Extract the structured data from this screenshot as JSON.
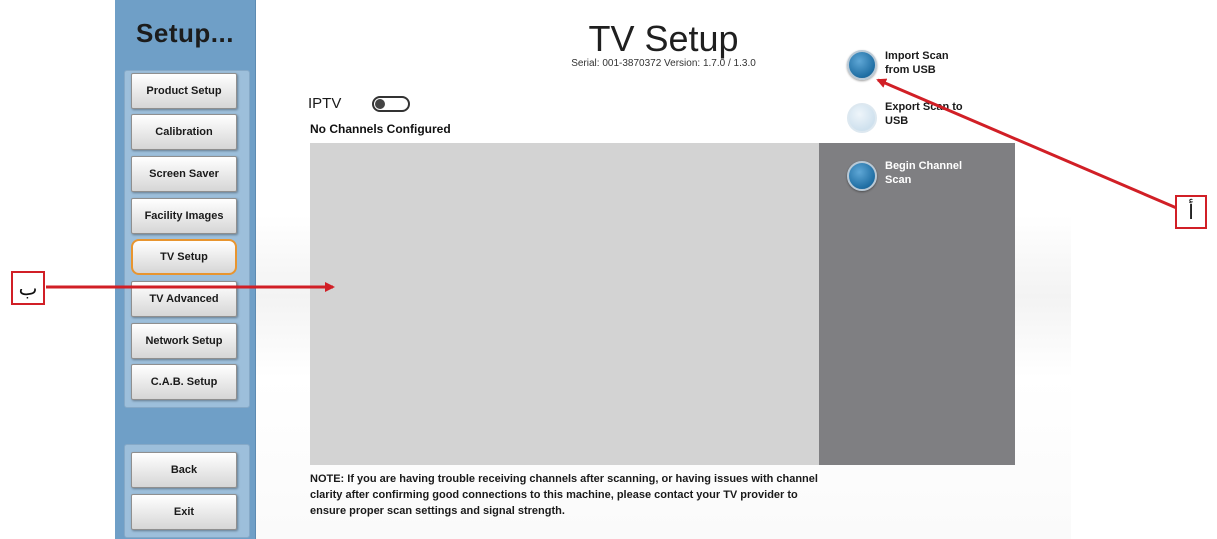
{
  "sidebar": {
    "title": "Setup...",
    "items": [
      {
        "label": "Product Setup",
        "active": false
      },
      {
        "label": "Calibration",
        "active": false
      },
      {
        "label": "Screen Saver",
        "active": false
      },
      {
        "label": "Facility Images",
        "active": false
      },
      {
        "label": "TV Setup",
        "active": true
      },
      {
        "label": "TV Advanced",
        "active": false
      },
      {
        "label": "Network Setup",
        "active": false
      },
      {
        "label": "C.A.B. Setup",
        "active": false
      }
    ],
    "bottom": {
      "back_label": "Back",
      "exit_label": "Exit"
    }
  },
  "header": {
    "title": "TV Setup",
    "serial_line": "Serial: 001-3870372   Version: 1.7.0 / 1.3.0"
  },
  "iptv": {
    "label": "IPTV",
    "enabled": false
  },
  "channels": {
    "status": "No Channels Configured",
    "items": []
  },
  "actions": {
    "import_line1": "Import Scan",
    "import_line2": "from USB",
    "export_line1": "Export Scan to",
    "export_line2": "USB",
    "scan_line1": "Begin Channel",
    "scan_line2": "Scan"
  },
  "note": "NOTE: If you are having trouble receiving channels after scanning, or having issues with channel clarity after confirming good connections to this machine, please contact your TV provider to ensure proper scan settings and signal strength.",
  "callouts": {
    "a": "أ",
    "b": "ب"
  },
  "colors": {
    "sidebar": "#6f9fc7",
    "accent_active": "#e8952f",
    "callout": "#d11f26",
    "scan_panel": "#7f7f82",
    "list_bg": "#d3d3d3"
  },
  "icons": {
    "import": "round-button-icon",
    "export": "round-button-disabled-icon",
    "scan": "round-button-icon"
  }
}
